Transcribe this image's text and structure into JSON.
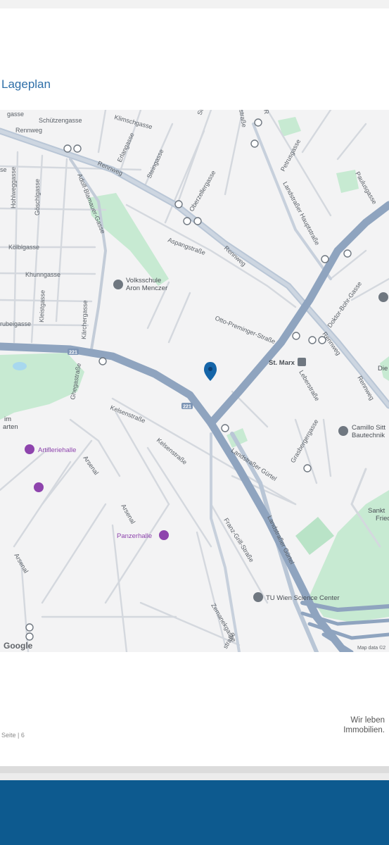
{
  "page": {
    "title": "Lageplan",
    "footer_page": "Seite | 6",
    "slogan_line1": "Wir leben",
    "slogan_line2": "Immobilien."
  },
  "map": {
    "attribution_logo": "Google",
    "attribution_data": "Map data ©2",
    "route_shield": "221",
    "colors": {
      "background": "#f3f3f4",
      "street": "#ffffff",
      "street_outline": "#cfd3d9",
      "highway": "#8fa4bf",
      "major_road": "#b9c6d6",
      "park": "#c7ead2",
      "pin": "#1565a8",
      "poi_purple": "#8e44ad"
    },
    "streets": {
      "rennweg": "Rennweg",
      "schuetzengasse": "Schützengasse",
      "klimschgasse": "Klimschgasse",
      "erlangasse": "Erlangasse",
      "steingasse": "Steingasse",
      "oberzellergasse": "Oberzellergasse",
      "hohlweggasse": "Hohlweggasse",
      "goeschlgasse": "Göschlgasse",
      "adolf_blamauer": "Adolf-Blamauer-Gasse",
      "koelblgasse": "Kölblgasse",
      "khunngasse": "Khunngasse",
      "kleistgasse": "Kleistgasse",
      "kaerchergasse": "Kärchergasse",
      "rubeigasse": "rubeigasse",
      "aspangstrasse": "Aspangstraße",
      "otto_preminger": "Otto-Preminger-Straße",
      "petrusgasse": "Petrusgasse",
      "landstrasser_hauptstrasse": "Landstraßer Hauptstraße",
      "paulusgasse": "Paulusgasse",
      "doktor_bohr": "Doktor-Bohr-Gasse",
      "leberstrasse": "Leberstraße",
      "ghegastrasse": "Ghegastraße",
      "kelsenstrasse": "Kelsenstraße",
      "grasbergergasse": "Grasbergergasse",
      "landstrasser_guertel": "Landstraßer Gürtel",
      "franz_grill": "Franz-Grill-Straße",
      "zemanekgasse": "Zemanekgasse",
      "arsenal": "Arsenal",
      "strasse_fragment": "straße",
      "gasse_fragment": "gasse",
      "se_fragment": "se",
      "r_fragment": "R",
      "st_fragment": "St"
    },
    "pois": {
      "volkshochschule": "Volksschule",
      "volkshochschule2": "Aron Menczer",
      "st_marx": "St. Marx",
      "camillo1": "Camillo Sitt",
      "camillo2": "Bautechnik",
      "artilleriehalle": "Artilleriehalle",
      "panzerhalle": "Panzerhalle",
      "tu_wien": "TU Wien Science Center",
      "sankt1": "Sankt",
      "sankt2": "Fried",
      "im_garten1": "im",
      "im_garten2": "arten",
      "die": "Die"
    }
  }
}
